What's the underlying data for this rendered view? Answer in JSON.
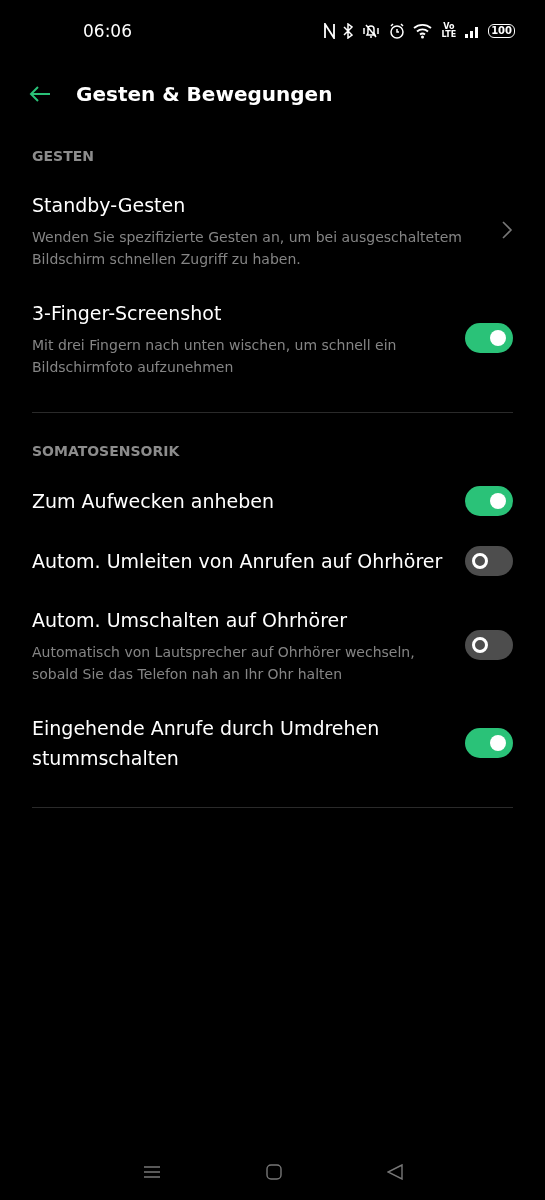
{
  "status_bar": {
    "time": "06:06",
    "volte": [
      "Vo",
      "LTE"
    ],
    "battery": "100"
  },
  "header": {
    "title": "Gesten & Bewegungen"
  },
  "sections": [
    {
      "label": "GESTEN",
      "items": [
        {
          "kind": "link",
          "title": "Standby-Gesten",
          "subtitle": "Wenden Sie spezifizierte Gesten an, um bei ausgeschaltetem Bildschirm schnellen Zugriff zu haben."
        },
        {
          "kind": "toggle",
          "title": "3-Finger-Screenshot",
          "subtitle": "Mit drei Fingern nach unten wischen, um schnell ein Bildschirmfoto aufzunehmen",
          "on": true
        }
      ]
    },
    {
      "label": "SOMATOSENSORIK",
      "items": [
        {
          "kind": "toggle",
          "title": "Zum Aufwecken anheben",
          "on": true
        },
        {
          "kind": "toggle",
          "title": "Autom. Umleiten von Anrufen auf Ohrhörer",
          "on": false
        },
        {
          "kind": "toggle",
          "title": "Autom. Umschalten auf Ohrhörer",
          "subtitle": "Automatisch von Lautsprecher auf Ohrhörer wechseln, sobald Sie das Telefon nah an Ihr Ohr halten",
          "on": false
        },
        {
          "kind": "toggle",
          "title": "Eingehende Anrufe durch Umdrehen stummschalten",
          "on": true
        }
      ]
    }
  ]
}
